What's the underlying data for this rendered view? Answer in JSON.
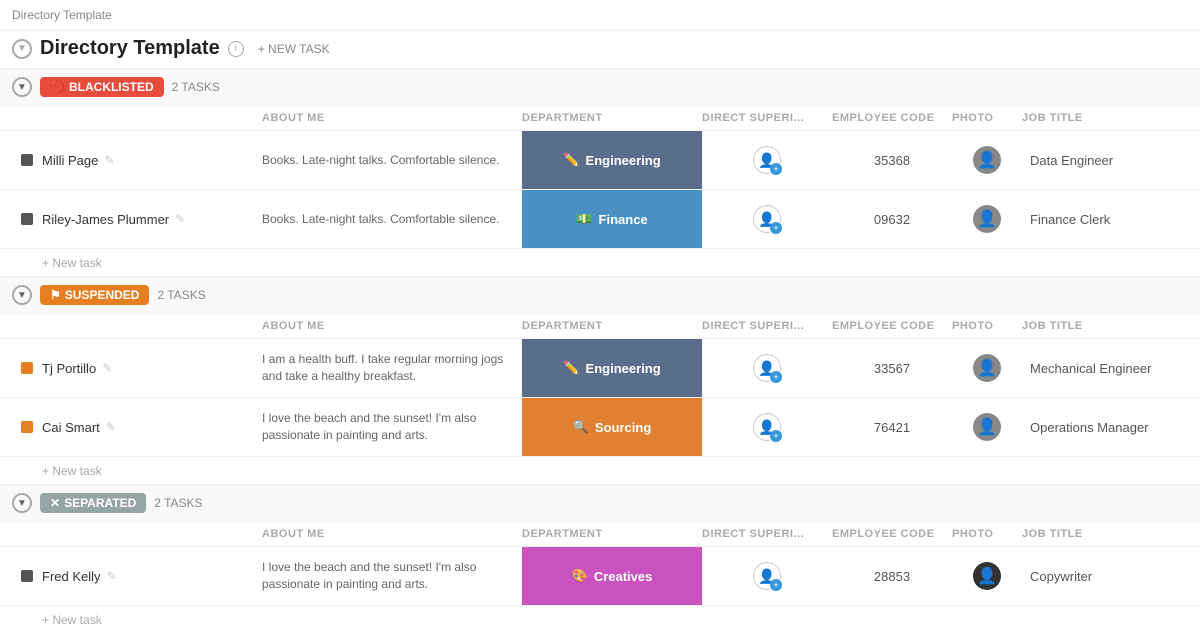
{
  "breadcrumb": "Directory Template",
  "title": "Directory Template",
  "new_task_label": "+ NEW TASK",
  "col_headers": {
    "about": "ABOUT ME",
    "department": "DEPARTMENT",
    "supervisor": "DIRECT SUPERI...",
    "empcode": "EMPLOYEE CODE",
    "photo": "PHOTO",
    "jobtitle": "JOB TITLE"
  },
  "sections": [
    {
      "id": "blacklisted",
      "badge": "BLACKLISTED",
      "badge_icon": "🚫",
      "badge_class": "badge-blacklisted",
      "tasks": "2 TASKS",
      "rows": [
        {
          "name": "Milli Page",
          "about": "Books. Late-night talks. Comfortable silence.",
          "department": "Engineering",
          "dept_icon": "✏️",
          "dept_class": "dept-engineering",
          "emp_code": "35368",
          "job_title": "Data Engineer",
          "check_class": "row-check-dark"
        },
        {
          "name": "Riley-James Plummer",
          "about": "Books. Late-night talks. Comfortable silence.",
          "department": "Finance",
          "dept_icon": "💵",
          "dept_class": "dept-finance",
          "emp_code": "09632",
          "job_title": "Finance Clerk",
          "check_class": "row-check-dark"
        }
      ]
    },
    {
      "id": "suspended",
      "badge": "SUSPENDED",
      "badge_icon": "⚑",
      "badge_class": "badge-suspended",
      "tasks": "2 TASKS",
      "rows": [
        {
          "name": "Tj Portillo",
          "about": "I am a health buff. I take regular morning jogs and take a healthy breakfast.",
          "department": "Engineering",
          "dept_icon": "✏️",
          "dept_class": "dept-engineering",
          "emp_code": "33567",
          "job_title": "Mechanical Engineer",
          "check_class": "row-check-orange"
        },
        {
          "name": "Cai Smart",
          "about": "I love the beach and the sunset! I'm also passionate in painting and arts.",
          "department": "Sourcing",
          "dept_icon": "🔍",
          "dept_class": "dept-sourcing",
          "emp_code": "76421",
          "job_title": "Operations Manager",
          "check_class": "row-check-orange"
        }
      ]
    },
    {
      "id": "separated",
      "badge": "SEPARATED",
      "badge_icon": "✕",
      "badge_class": "badge-separated",
      "tasks": "2 TASKS",
      "rows": [
        {
          "name": "Fred Kelly",
          "about": "I love the beach and the sunset! I'm also passionate in painting and arts.",
          "department": "Creatives",
          "dept_icon": "🎨",
          "dept_class": "dept-creatives",
          "emp_code": "28853",
          "job_title": "Copywriter",
          "check_class": "row-check-dark",
          "photo_dark": true
        }
      ]
    }
  ],
  "add_task_label": "+ New task"
}
